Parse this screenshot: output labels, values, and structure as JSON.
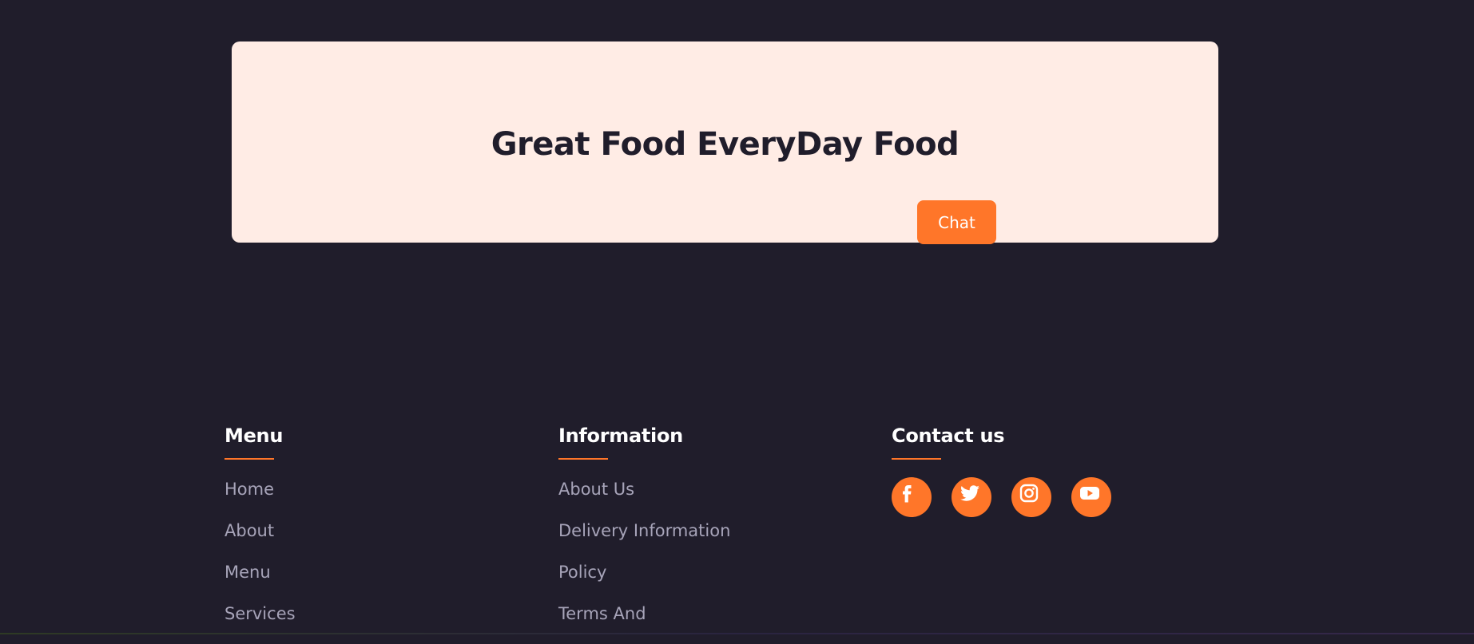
{
  "cta": {
    "title": "Great Food EveryDay Food",
    "button_label": "Chat"
  },
  "footer": {
    "menu": {
      "heading": "Menu",
      "links": [
        "Home",
        "About",
        "Menu",
        "Services"
      ]
    },
    "information": {
      "heading": "Information",
      "links": [
        "About Us",
        "Delivery Information",
        "Policy",
        "Terms And"
      ]
    },
    "contact": {
      "heading": "Contact us",
      "social_icons": [
        "facebook-icon",
        "twitter-icon",
        "instagram-icon",
        "youtube-icon"
      ]
    }
  },
  "colors": {
    "background": "#201d2b",
    "card_background": "#ffece5",
    "accent": "#ff7629",
    "link_text": "#a7a4b9",
    "heading_text": "#ffffff"
  }
}
